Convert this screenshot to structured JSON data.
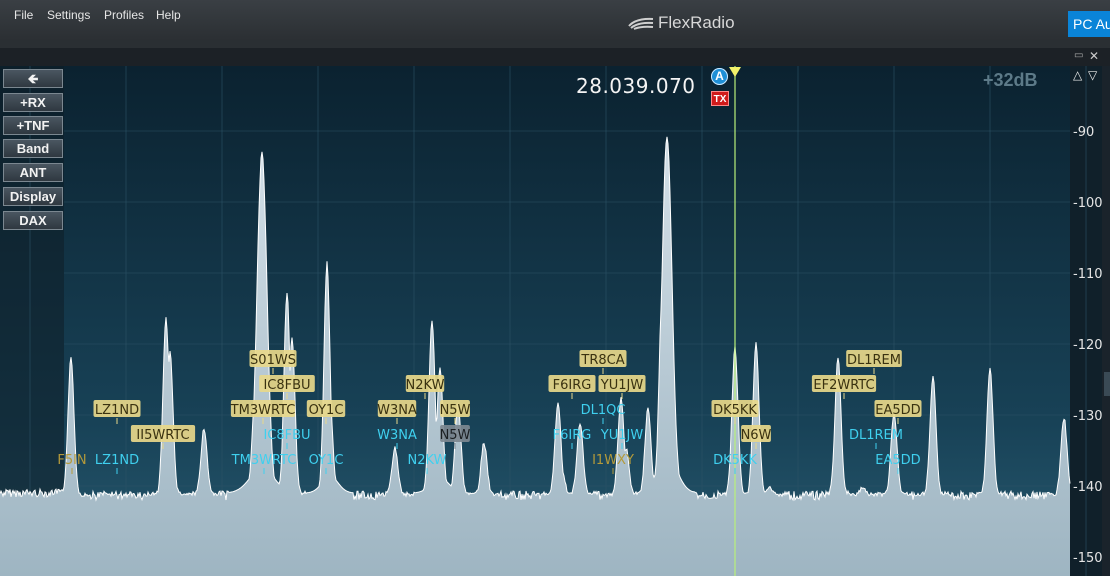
{
  "menubar": {
    "items": [
      "File",
      "Settings",
      "Profiles",
      "Help"
    ],
    "brand": "FlexRadio",
    "right_button": "PC Audio"
  },
  "side_buttons": [
    {
      "label": "",
      "icon": "back-arrow-icon"
    },
    {
      "label": "+RX"
    },
    {
      "label": "+TNF"
    },
    {
      "label": "Band"
    },
    {
      "label": "ANT"
    },
    {
      "label": "Display"
    },
    {
      "label": "DAX"
    }
  ],
  "panadapter": {
    "frequency": "28.039.070",
    "slice_letter": "A",
    "tx_label": "TX",
    "gain": "+32dB",
    "db_scale": [
      "-90",
      "-100",
      "-110",
      "-120",
      "-130",
      "-140",
      "-150"
    ],
    "colors": {
      "background_top": "#0c2433",
      "background_bottom": "#1e4c63",
      "spectrum_fill": "#c5d4de",
      "spectrum_line": "#ffffff",
      "spot_yellow": "#d9c36a",
      "spot_cyan": "#39c8e6",
      "slice_marker": "#f2f26a"
    },
    "spots": [
      {
        "call": "S01WS",
        "row": 1,
        "style": "yellow"
      },
      {
        "call": "TR8CA",
        "row": 1,
        "style": "yellow"
      },
      {
        "call": "DL1REM",
        "row": 1,
        "style": "yellow"
      },
      {
        "call": "IC8FBU",
        "row": 2,
        "style": "yellow"
      },
      {
        "call": "N2KW",
        "row": 2,
        "style": "yellow"
      },
      {
        "call": "F6IRG",
        "row": 2,
        "style": "yellow"
      },
      {
        "call": "YU1JW",
        "row": 2,
        "style": "yellow"
      },
      {
        "call": "EF2WRTC",
        "row": 2,
        "style": "yellow"
      },
      {
        "call": "LZ1ND",
        "row": 3,
        "style": "yellow"
      },
      {
        "call": "TM3WRTC",
        "row": 3,
        "style": "yellow"
      },
      {
        "call": "OY1C",
        "row": 3,
        "style": "yellow"
      },
      {
        "call": "W3NA",
        "row": 3,
        "style": "yellow"
      },
      {
        "call": "N5W",
        "row": 3,
        "style": "yellow"
      },
      {
        "call": "DL1QC",
        "row": 3,
        "style": "cyan"
      },
      {
        "call": "DK5KK",
        "row": 3,
        "style": "yellow"
      },
      {
        "call": "EA5DD",
        "row": 3,
        "style": "yellow"
      },
      {
        "call": "II5WRTC",
        "row": 4,
        "style": "yellow"
      },
      {
        "call": "IC8FBU",
        "row": 4,
        "style": "cyan"
      },
      {
        "call": "W3NA",
        "row": 4,
        "style": "cyan"
      },
      {
        "call": "N5W",
        "row": 4,
        "style": "gray"
      },
      {
        "call": "F6IRG",
        "row": 4,
        "style": "cyan"
      },
      {
        "call": "YU1JW",
        "row": 4,
        "style": "cyan"
      },
      {
        "call": "N6W",
        "row": 4,
        "style": "yellow"
      },
      {
        "call": "DL1REM",
        "row": 4,
        "style": "cyan"
      },
      {
        "call": "F5IN",
        "row": 5,
        "style": "darkyellow"
      },
      {
        "call": "LZ1ND",
        "row": 5,
        "style": "cyan"
      },
      {
        "call": "TM3WRTC",
        "row": 5,
        "style": "cyan"
      },
      {
        "call": "OY1C",
        "row": 5,
        "style": "cyan"
      },
      {
        "call": "N2KW",
        "row": 5,
        "style": "cyan"
      },
      {
        "call": "I1WXY",
        "row": 5,
        "style": "darkyellow"
      },
      {
        "call": "DK5KK",
        "row": 5,
        "style": "cyan"
      },
      {
        "call": "EA5DD",
        "row": 5,
        "style": "cyan"
      }
    ]
  }
}
